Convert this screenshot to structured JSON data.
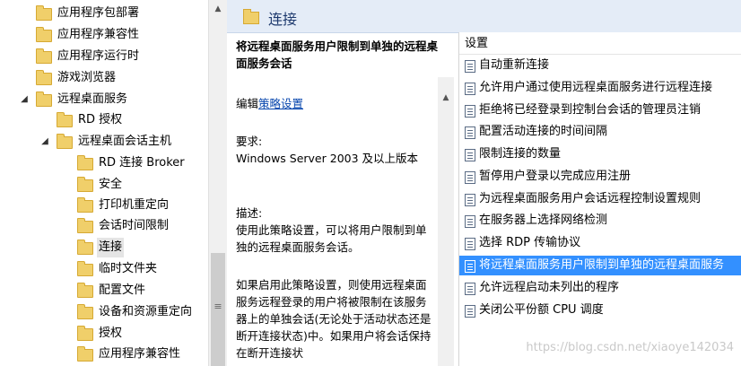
{
  "tree": {
    "items": [
      {
        "label": "应用程序包部署",
        "expanded": null
      },
      {
        "label": "应用程序兼容性",
        "expanded": null
      },
      {
        "label": "应用程序运行时",
        "expanded": null
      },
      {
        "label": "游戏浏览器",
        "expanded": null
      },
      {
        "label": "远程桌面服务",
        "expanded": true
      },
      {
        "label": "RD 授权",
        "expanded": null
      },
      {
        "label": "远程桌面会话主机",
        "expanded": true
      },
      {
        "label": "RD 连接 Broker",
        "expanded": null
      },
      {
        "label": "安全",
        "expanded": null
      },
      {
        "label": "打印机重定向",
        "expanded": null
      },
      {
        "label": "会话时间限制",
        "expanded": null
      },
      {
        "label": "连接",
        "expanded": null,
        "selected": true
      },
      {
        "label": "临时文件夹",
        "expanded": null
      },
      {
        "label": "配置文件",
        "expanded": null
      },
      {
        "label": "设备和资源重定向",
        "expanded": null
      },
      {
        "label": "授权",
        "expanded": null
      },
      {
        "label": "应用程序兼容性",
        "expanded": null
      }
    ]
  },
  "header": {
    "title": "连接",
    "icon": "folder-icon"
  },
  "description": {
    "title": "将远程桌面服务用户限制到单独的远程桌面服务会话",
    "edit_prefix": "编辑",
    "edit_link": "策略设置",
    "requirements_label": "要求:",
    "requirements_text": "Windows Server 2003 及以上版本",
    "desc_label": "描述:",
    "desc_text": "使用此策略设置，可以将用户限制到单独的远程桌面服务会话。",
    "desc_more": "如果启用此策略设置，则使用远程桌面服务远程登录的用户将被限制在该服务器上的单独会话(无论处于活动状态还是断开连接状态)中。如果用户将会话保持在断开连接状"
  },
  "settings": {
    "column_header": "设置",
    "items": [
      {
        "label": "自动重新连接"
      },
      {
        "label": "允许用户通过使用远程桌面服务进行远程连接"
      },
      {
        "label": "拒绝将已经登录到控制台会话的管理员注销"
      },
      {
        "label": "配置活动连接的时间间隔"
      },
      {
        "label": "限制连接的数量"
      },
      {
        "label": "暂停用户登录以完成应用注册"
      },
      {
        "label": "为远程桌面服务用户会话远程控制设置规则"
      },
      {
        "label": "在服务器上选择网络检测"
      },
      {
        "label": "选择 RDP 传输协议"
      },
      {
        "label": "将远程桌面服务用户限制到单独的远程桌面服务",
        "selected": true
      },
      {
        "label": "允许远程启动未列出的程序"
      },
      {
        "label": "关闭公平份额 CPU 调度"
      }
    ]
  },
  "watermark": "https://blog.csdn.net/xiaoye142034",
  "colors": {
    "selection": "#3390ff",
    "header_bg": "#e4ecf7",
    "folder": "#f0cf6a",
    "link": "#0645ad"
  }
}
